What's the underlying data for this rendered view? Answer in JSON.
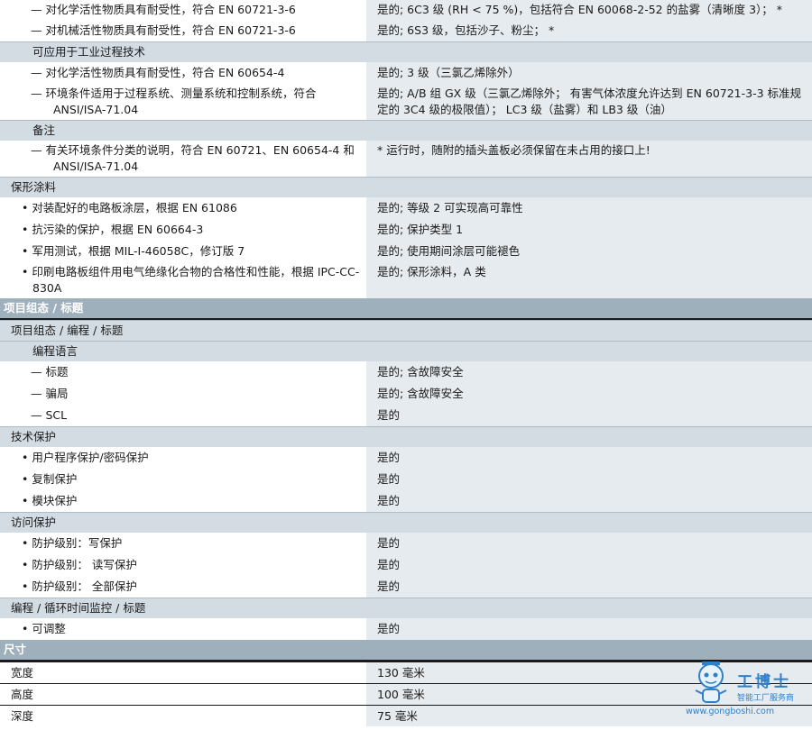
{
  "rows": [
    {
      "kind": "item",
      "style": "dash tall",
      "left": "— 对化学活性物质具有耐受性，符合 EN 60721-3-6",
      "right": "是的; 6C3 级 (RH < 75 %)，包括符合 EN 60068-2-52 的盐雾（清晰度 3）； *"
    },
    {
      "kind": "item",
      "style": "dash",
      "left": "— 对机械活性物质具有耐受性，符合 EN 60721-3-6",
      "right": "是的; 6S3 级，包括沙子、粉尘； *"
    },
    {
      "kind": "grp",
      "style": "sub",
      "left": "可应用于工业过程技术"
    },
    {
      "kind": "item",
      "style": "dash",
      "left": "— 对化学活性物质具有耐受性，符合 EN 60654-4",
      "right": "是的; 3 级（三氯乙烯除外）"
    },
    {
      "kind": "item",
      "style": "dash tall",
      "left": "— 环境条件适用于过程系统、测量系统和控制系统，符合 ANSI/ISA-71.04",
      "right": "是的; A/B 组 GX 级（三氯乙烯除外； 有害气体浓度允许达到 EN 60721-3-3 标准规定的 3C4 级的极限值）； LC3 级（盐雾）和 LB3 级（油）"
    },
    {
      "kind": "grp",
      "style": "sub",
      "left": "备注"
    },
    {
      "kind": "item",
      "style": "dash tall",
      "left": "— 有关环境条件分类的说明，符合 EN 60721、EN 60654-4 和 ANSI/ISA-71.04",
      "right": "* 运行时，随附的插头盖板必须保留在未占用的接口上!"
    },
    {
      "kind": "grp",
      "style": "",
      "left": "保形涂料"
    },
    {
      "kind": "item",
      "style": "bullet",
      "left": "对装配好的电路板涂层，根据 EN 61086",
      "right": "是的; 等级 2 可实现高可靠性"
    },
    {
      "kind": "item",
      "style": "bullet",
      "left": "抗污染的保护，根据 EN 60664-3",
      "right": "是的; 保护类型 1"
    },
    {
      "kind": "item",
      "style": "bullet",
      "left": "军用测试，根据 MIL-I-46058C，修订版 7",
      "right": "是的; 使用期间涂层可能褪色"
    },
    {
      "kind": "item",
      "style": "bullet tall",
      "left": "印刷电路板组件用电气绝缘化合物的合格性和性能，根据 IPC-CC-830A",
      "right": "是的; 保形涂料，A 类"
    },
    {
      "kind": "sect",
      "style": "",
      "left": "项目组态 / 标题"
    },
    {
      "kind": "grp",
      "style": "",
      "left": "项目组态 / 编程 / 标题"
    },
    {
      "kind": "grp",
      "style": "sub",
      "left": "编程语言"
    },
    {
      "kind": "item",
      "style": "dash",
      "left": "— 标题",
      "right": "是的; 含故障安全"
    },
    {
      "kind": "item",
      "style": "dash",
      "left": "— 骗局",
      "right": "是的; 含故障安全"
    },
    {
      "kind": "item",
      "style": "dash",
      "left": "— SCL",
      "right": "是的"
    },
    {
      "kind": "grp",
      "style": "",
      "left": "技术保护"
    },
    {
      "kind": "item",
      "style": "bullet",
      "left": "用户程序保护/密码保护",
      "right": "是的"
    },
    {
      "kind": "item",
      "style": "bullet",
      "left": "复制保护",
      "right": "是的"
    },
    {
      "kind": "item",
      "style": "bullet",
      "left": "模块保护",
      "right": "是的"
    },
    {
      "kind": "grp",
      "style": "",
      "left": "访问保护"
    },
    {
      "kind": "item",
      "style": "bullet",
      "left": "防护级别：写保护",
      "right": "是的"
    },
    {
      "kind": "item",
      "style": "bullet",
      "left": "防护级别： 读写保护",
      "right": "是的"
    },
    {
      "kind": "item",
      "style": "bullet",
      "left": "防护级别： 全部保护",
      "right": "是的"
    },
    {
      "kind": "grp",
      "style": "",
      "left": "编程 / 循环时间监控 / 标题"
    },
    {
      "kind": "item",
      "style": "bullet",
      "left": "可调整",
      "right": "是的"
    },
    {
      "kind": "sect",
      "style": "",
      "left": "尺寸"
    },
    {
      "kind": "dim",
      "style": "",
      "left": "宽度",
      "right": "130 毫米"
    },
    {
      "kind": "dim",
      "style": "",
      "left": "高度",
      "right": "100 毫米"
    },
    {
      "kind": "dim",
      "style": "",
      "left": "深度",
      "right": "75 毫米"
    }
  ],
  "watermark": {
    "brand": "工博士",
    "tagline": "智能工厂服务商",
    "url": "www.gongboshi.com"
  },
  "colors": {
    "group_bg": "#d4dce3",
    "section_bg": "#9fb0bd",
    "value_bg": "#e6ebef",
    "watermark": "#2f80c8"
  }
}
